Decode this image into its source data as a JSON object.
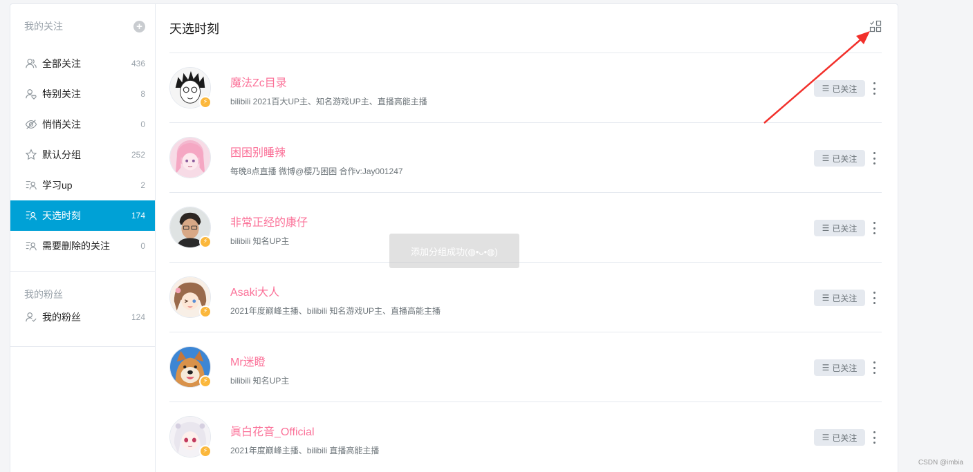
{
  "sidebar": {
    "following_title": "我的关注",
    "items": [
      {
        "label": "全部关注",
        "count": "436",
        "icon": "users-icon"
      },
      {
        "label": "特别关注",
        "count": "8",
        "icon": "heart-user-icon"
      },
      {
        "label": "悄悄关注",
        "count": "0",
        "icon": "eye-slash-icon"
      },
      {
        "label": "默认分组",
        "count": "252",
        "icon": "star-icon"
      },
      {
        "label": "学习up",
        "count": "2",
        "icon": "list-user-icon"
      },
      {
        "label": "天选时刻",
        "count": "174",
        "icon": "list-user-icon",
        "active": true
      },
      {
        "label": "需要删除的关注",
        "count": "0",
        "icon": "list-user-icon"
      }
    ],
    "fans_title": "我的粉丝",
    "fans_item": {
      "label": "我的粉丝",
      "count": "124",
      "icon": "user-check-icon"
    }
  },
  "main": {
    "title": "天选时刻",
    "users": [
      {
        "name": "魔法Zc目录",
        "desc": "bilibili 2021百大UP主、知名游戏UP主、直播高能主播",
        "verified": true
      },
      {
        "name": "困困别睡辣",
        "desc": "每晚8点直播 微博@樱乃困困 合作v:Jay001247",
        "verified": false
      },
      {
        "name": "非常正经的康仔",
        "desc": "bilibili 知名UP主",
        "verified": true
      },
      {
        "name": "Asaki大人",
        "desc": "2021年度巅峰主播、bilibili 知名游戏UP主、直播高能主播",
        "verified": true
      },
      {
        "name": "Mr迷瞪",
        "desc": "bilibili 知名UP主",
        "verified": true
      },
      {
        "name": "眞白花音_Official",
        "desc": "2021年度巅峰主播、bilibili 直播高能主播",
        "verified": true
      }
    ],
    "follow_label": "已关注"
  },
  "toast": {
    "text": "添加分组成功(◍•ᴗ•◍)"
  },
  "watermark": "CSDN @imbia",
  "colors": {
    "accent": "#00a1d6",
    "name_pink": "#fb7299",
    "verify_yellow": "#fbb73b",
    "arrow_red": "#f2302b"
  }
}
